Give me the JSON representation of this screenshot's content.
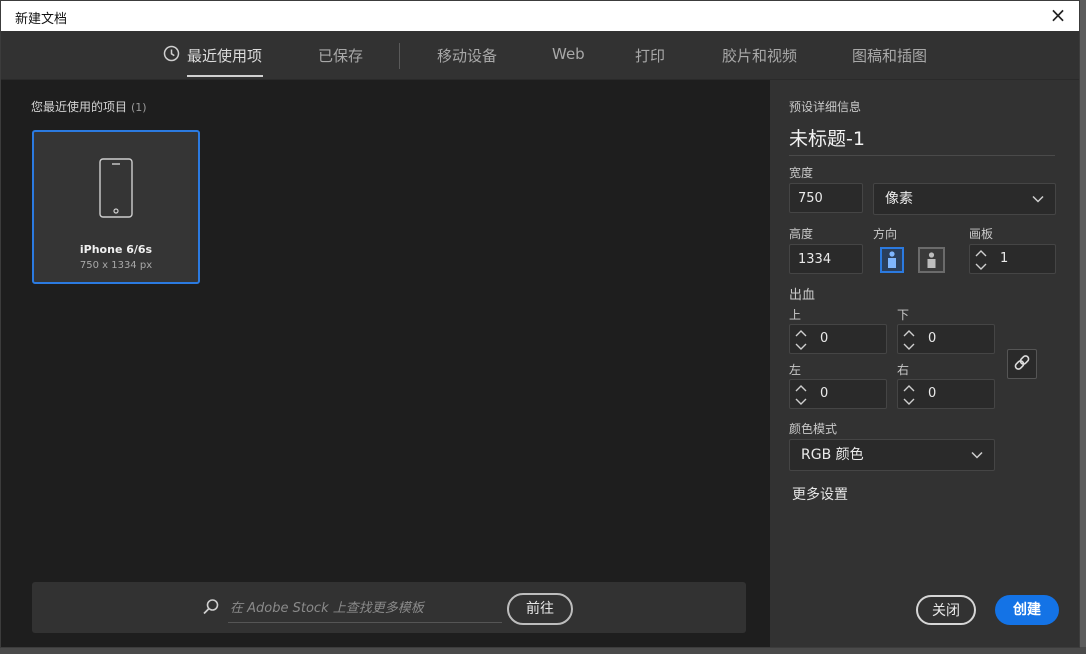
{
  "window": {
    "title": "新建文档",
    "close_glyph": "×"
  },
  "tabs": [
    {
      "label": "最近使用项",
      "active": true
    },
    {
      "label": "已保存"
    },
    {
      "label": "移动设备"
    },
    {
      "label": "Web"
    },
    {
      "label": "打印"
    },
    {
      "label": "胶片和视频"
    },
    {
      "label": "图稿和插图"
    }
  ],
  "recent": {
    "label": "您最近使用的项目",
    "count": "(1)",
    "items": [
      {
        "name": "iPhone 6/6s",
        "size": "750 x 1334 px"
      }
    ]
  },
  "stock": {
    "placeholder": "在 Adobe Stock 上查找更多模板",
    "go_label": "前往"
  },
  "details": {
    "title": "预设详细信息",
    "doc_name": "未标题-1",
    "width_label": "宽度",
    "width_value": "750",
    "unit": "像素",
    "height_label": "高度",
    "height_value": "1334",
    "orientation_label": "方向",
    "artboards_label": "画板",
    "artboards_value": "1",
    "bleed_label": "出血",
    "bleed": {
      "top_label": "上",
      "top_value": "0",
      "bottom_label": "下",
      "bottom_value": "0",
      "left_label": "左",
      "left_value": "0",
      "right_label": "右",
      "right_value": "0"
    },
    "color_mode_label": "颜色模式",
    "color_mode_value": "RGB 颜色",
    "more_settings": "更多设置",
    "close_label": "关闭",
    "create_label": "创建"
  },
  "colors": {
    "accent": "#1473e6",
    "selected_border": "#2b7ae0",
    "panel_bg": "#323232",
    "main_bg": "#1e1e1e"
  }
}
